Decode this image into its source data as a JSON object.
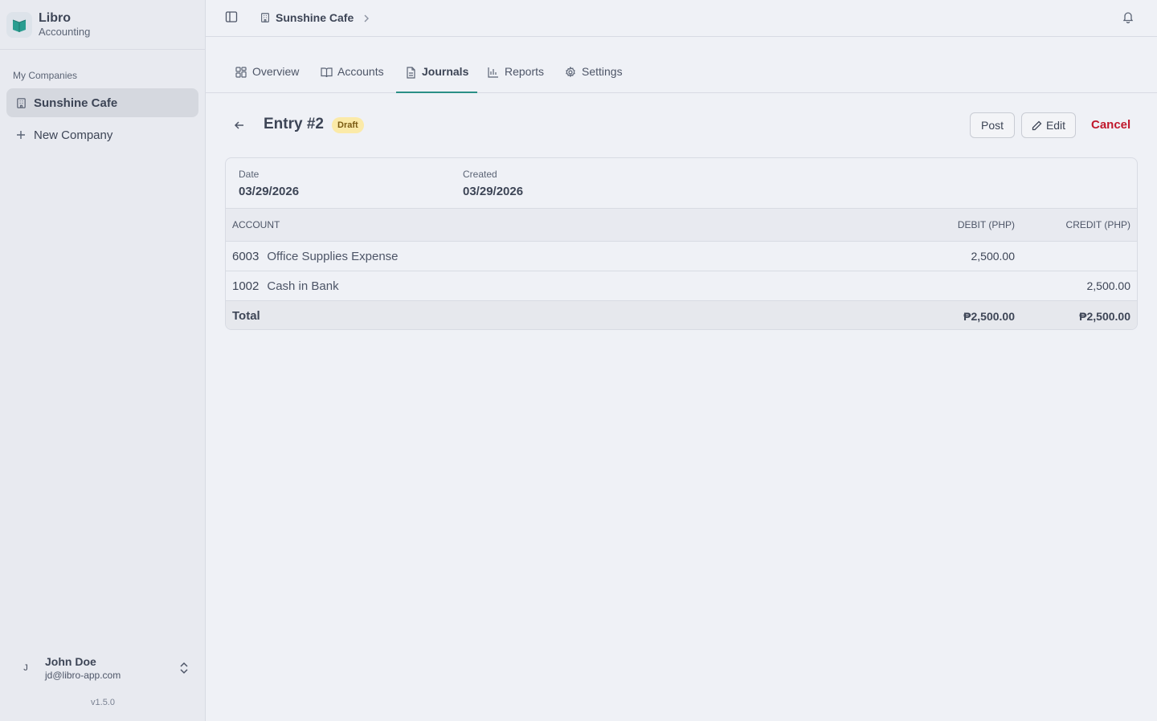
{
  "app": {
    "name": "Libro",
    "subtitle": "Accounting",
    "version": "v1.5.0"
  },
  "sidebar": {
    "section_label": "My Companies",
    "items": [
      {
        "label": "Sunshine Cafe",
        "icon": "building-icon",
        "active": true
      },
      {
        "label": "New Company",
        "icon": "plus-icon",
        "active": false
      }
    ],
    "user": {
      "initial": "J",
      "name": "John Doe",
      "email": "jd@libro-app.com"
    }
  },
  "topbar": {
    "breadcrumb": "Sunshine Cafe"
  },
  "tabs": [
    {
      "label": "Overview",
      "icon": "grid-icon"
    },
    {
      "label": "Accounts",
      "icon": "book-icon"
    },
    {
      "label": "Journals",
      "icon": "document-icon",
      "active": true
    },
    {
      "label": "Reports",
      "icon": "bar-chart-icon"
    },
    {
      "label": "Settings",
      "icon": "gear-icon"
    }
  ],
  "entry": {
    "title": "Entry #2",
    "status": "Draft",
    "actions": {
      "post": "Post",
      "edit": "Edit",
      "cancel": "Cancel"
    },
    "date_label": "Date",
    "date_value": "03/29/2026",
    "created_label": "Created",
    "created_value": "03/29/2026"
  },
  "table": {
    "headers": {
      "account": "ACCOUNT",
      "debit": "DEBIT (PHP)",
      "credit": "CREDIT (PHP)"
    },
    "rows": [
      {
        "code": "6003",
        "name": "Office Supplies Expense",
        "debit": "2,500.00",
        "credit": ""
      },
      {
        "code": "1002",
        "name": "Cash in Bank",
        "debit": "",
        "credit": "2,500.00"
      }
    ],
    "total": {
      "label": "Total",
      "debit": "₱2,500.00",
      "credit": "₱2,500.00"
    }
  },
  "colors": {
    "accent": "#2a8f86",
    "danger": "#c0182c",
    "badge_bg": "#fbeaa8"
  }
}
